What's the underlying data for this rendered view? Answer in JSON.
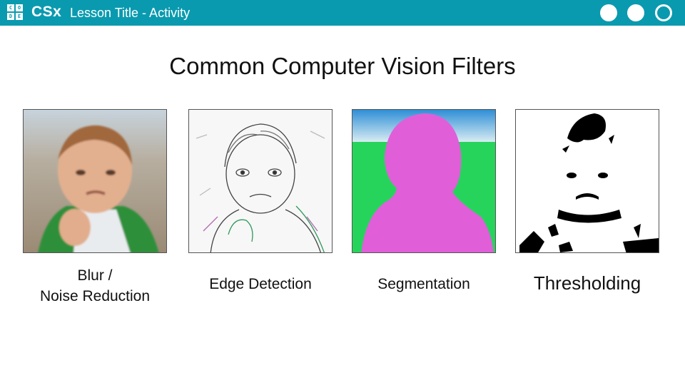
{
  "header": {
    "logo_letters": [
      "C",
      "O",
      "D",
      "E"
    ],
    "brand": "CSx",
    "lesson_title": "Lesson Title - Activity",
    "accent_color": "#0a9aaf"
  },
  "slide": {
    "title": "Common Computer Vision Filters",
    "filters": [
      {
        "line1": "Blur /",
        "line2": "Noise Reduction"
      },
      {
        "label": "Edge Detection"
      },
      {
        "label": "Segmentation"
      },
      {
        "label": "Thresholding"
      }
    ]
  }
}
